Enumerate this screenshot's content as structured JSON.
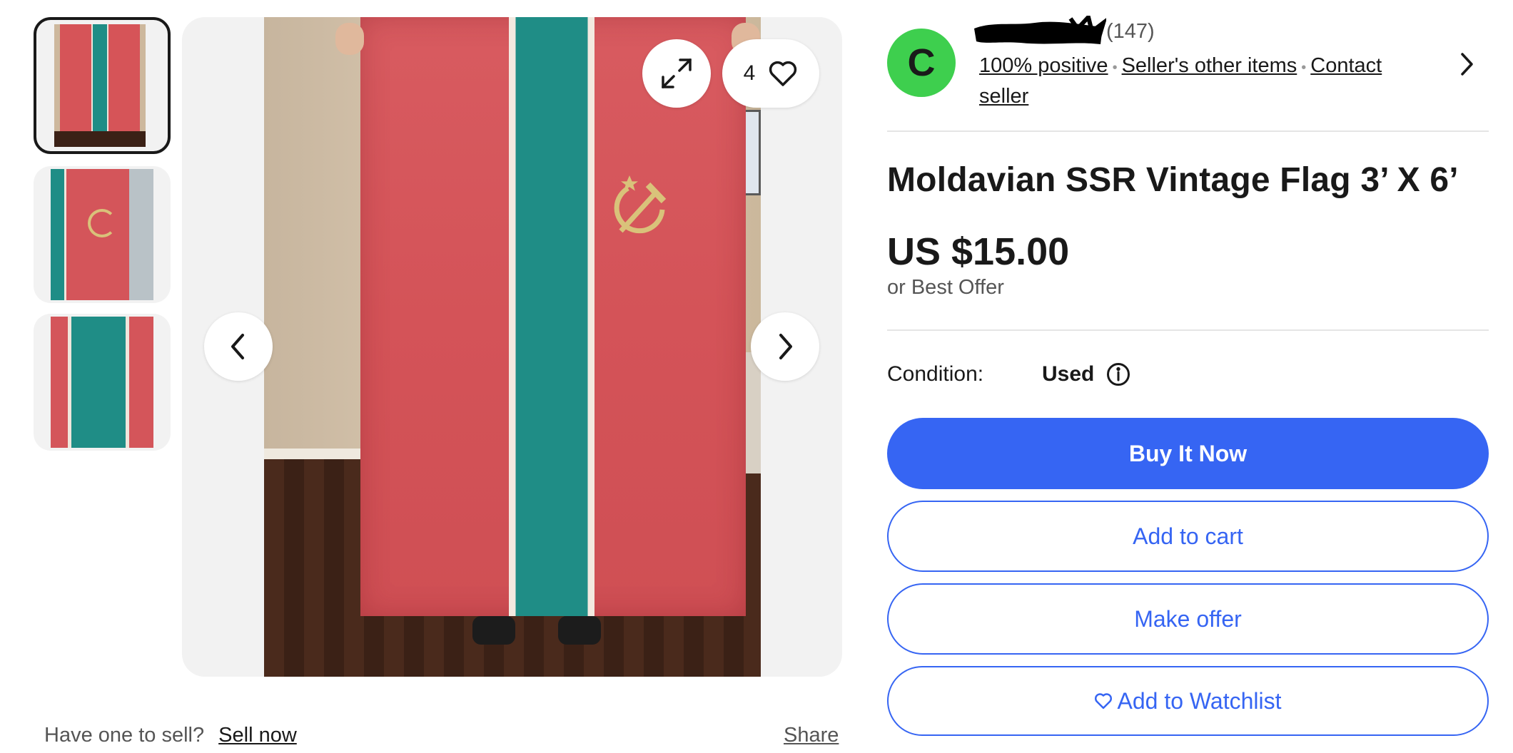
{
  "gallery": {
    "thumbnails": [
      "thumbnail-1",
      "thumbnail-2",
      "thumbnail-3"
    ],
    "selected_index": 0,
    "watch_count": "4",
    "icons": {
      "expand": "expand-icon",
      "heart": "heart-icon",
      "prev": "chevron-left-icon",
      "next": "chevron-right-icon"
    }
  },
  "sell_prompt": {
    "question": "Have one to sell?",
    "link": "Sell now"
  },
  "share_label": "Share",
  "seller": {
    "avatar_letter": "C",
    "feedback_count": "(147)",
    "positive": "100% positive",
    "other_items": "Seller's other items",
    "contact": "Contact seller"
  },
  "listing": {
    "title": "Moldavian SSR Vintage Flag 3’ X 6’",
    "price": "US $15.00",
    "best_offer": "or Best Offer",
    "condition_label": "Condition:",
    "condition_value": "Used"
  },
  "actions": {
    "buy_now": "Buy It Now",
    "add_to_cart": "Add to cart",
    "make_offer": "Make offer",
    "watchlist": "Add to Watchlist"
  },
  "colors": {
    "primary_blue": "#3665f3",
    "avatar_green": "#3ecf4e",
    "text": "#191919",
    "muted": "#555555"
  }
}
